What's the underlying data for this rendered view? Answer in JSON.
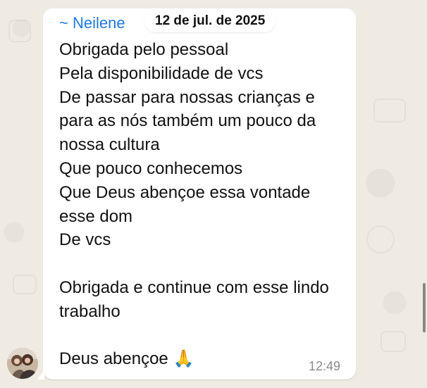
{
  "conversation": {
    "sender_name": "~ Neilene",
    "date_label": "12 de jul. de 2025",
    "message_text": "Obrigada pelo pessoal\nPela disponibilidade de vcs\nDe passar para nossas crianças e para as nós também um pouco da nossa cultura\nQue pouco conhecemos\nQue Deus abençoe essa vontade esse dom\nDe vcs\n\nObrigada e continue com esse lindo trabalho\n\nDeus abençoe 🙏",
    "timestamp": "12:49"
  },
  "icons": {
    "avatar": "contact-photo"
  },
  "colors": {
    "sender": "#1f7ae0",
    "background": "#efeae2",
    "bubble": "#ffffff",
    "timestamp": "#8a8a8a"
  }
}
